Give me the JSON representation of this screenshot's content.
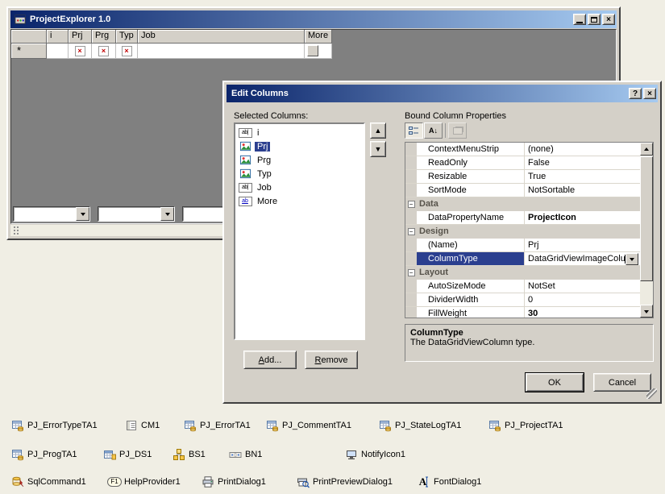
{
  "colors": {
    "titlebar_start": "#0a246a",
    "titlebar_end": "#a6caf0",
    "selection": "#2b3f8f",
    "face": "#d4d0c8",
    "workspace": "#808080"
  },
  "icons": {
    "textbox": "ab|",
    "link": "ab",
    "help_provider": "F1",
    "font_dialog": "A",
    "broken_image": "×",
    "close": "×",
    "help": "?",
    "move_up": "▲",
    "move_down": "▼",
    "collapse": "−",
    "sort_alpha": "A↓"
  },
  "main_window": {
    "title": "ProjectExplorer 1.0",
    "grid": {
      "row_header_marker": "*",
      "columns": [
        {
          "header": "i"
        },
        {
          "header": "Prj",
          "new_row_icon": "broken-image"
        },
        {
          "header": "Prg",
          "new_row_icon": "broken-image"
        },
        {
          "header": "Typ",
          "new_row_icon": "broken-image"
        },
        {
          "header": "Job"
        },
        {
          "header": "More",
          "new_row_icon": "image-box"
        }
      ]
    }
  },
  "dialog": {
    "title": "Edit Columns",
    "selected_columns_label": "Selected Columns:",
    "columns_list": [
      {
        "label": "i",
        "icon": "textbox",
        "selected": false
      },
      {
        "label": "Prj",
        "icon": "image",
        "selected": true
      },
      {
        "label": "Prg",
        "icon": "image",
        "selected": false
      },
      {
        "label": "Typ",
        "icon": "image",
        "selected": false
      },
      {
        "label": "Job",
        "icon": "textbox",
        "selected": false
      },
      {
        "label": "More",
        "icon": "link",
        "selected": false
      }
    ],
    "add_button": "Add...",
    "remove_button": "Remove",
    "bound_properties_label": "Bound Column Properties",
    "property_rows": [
      {
        "kind": "property",
        "name": "ContextMenuStrip",
        "value": "(none)"
      },
      {
        "kind": "property",
        "name": "ReadOnly",
        "value": "False"
      },
      {
        "kind": "property",
        "name": "Resizable",
        "value": "True"
      },
      {
        "kind": "property",
        "name": "SortMode",
        "value": "NotSortable"
      },
      {
        "kind": "category",
        "name": "Data"
      },
      {
        "kind": "property",
        "name": "DataPropertyName",
        "value": "ProjectIcon",
        "modified": true
      },
      {
        "kind": "category",
        "name": "Design"
      },
      {
        "kind": "property",
        "name": "(Name)",
        "value": "Prj"
      },
      {
        "kind": "property",
        "name": "ColumnType",
        "value": "DataGridViewImageColumn",
        "selected": true,
        "editor": "dropdown"
      },
      {
        "kind": "category",
        "name": "Layout"
      },
      {
        "kind": "property",
        "name": "AutoSizeMode",
        "value": "NotSet"
      },
      {
        "kind": "property",
        "name": "DividerWidth",
        "value": "0"
      },
      {
        "kind": "property",
        "name": "FillWeight",
        "value": "30",
        "modified": true
      }
    ],
    "description": {
      "title": "ColumnType",
      "text": "The DataGridViewColumn type."
    },
    "ok_button": "OK",
    "cancel_button": "Cancel"
  },
  "component_tray": {
    "components": [
      {
        "label": "PJ_ErrorTypeTA1",
        "icon": "table-adapter"
      },
      {
        "label": "CM1",
        "icon": "context-menu"
      },
      {
        "label": "PJ_ErrorTA1",
        "icon": "table-adapter"
      },
      {
        "label": "PJ_CommentTA1",
        "icon": "table-adapter"
      },
      {
        "label": "PJ_StateLogTA1",
        "icon": "table-adapter"
      },
      {
        "label": "PJ_ProjectTA1",
        "icon": "table-adapter"
      },
      {
        "label": "PJ_ProgTA1",
        "icon": "table-adapter"
      },
      {
        "label": "PJ_DS1",
        "icon": "dataset"
      },
      {
        "label": "BS1",
        "icon": "binding-source"
      },
      {
        "label": "BN1",
        "icon": "binding-navigator"
      },
      {
        "label": "NotifyIcon1",
        "icon": "notify-icon"
      },
      {
        "label": "SqlCommand1",
        "icon": "sql-command"
      },
      {
        "label": "HelpProvider1",
        "icon": "help-provider"
      },
      {
        "label": "PrintDialog1",
        "icon": "print-dialog"
      },
      {
        "label": "PrintPreviewDialog1",
        "icon": "print-preview"
      },
      {
        "label": "FontDialog1",
        "icon": "font-dialog"
      }
    ]
  }
}
